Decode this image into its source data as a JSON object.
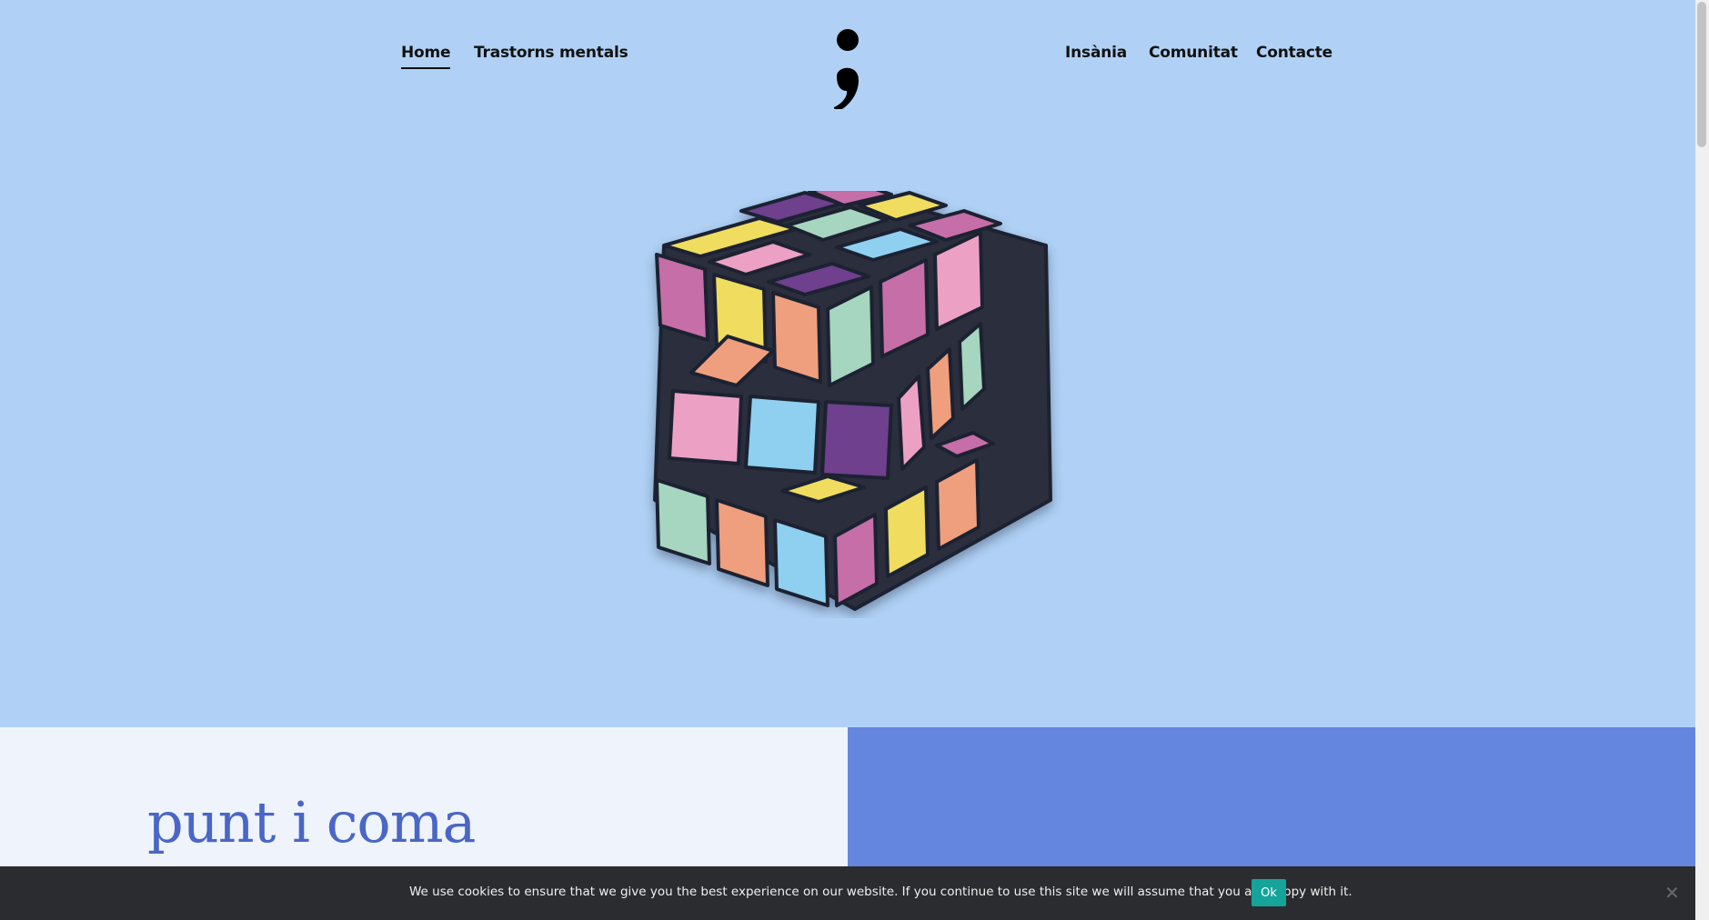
{
  "nav": {
    "left": [
      {
        "label": "Home",
        "active": true
      },
      {
        "label": "Trastorns mentals",
        "active": false
      }
    ],
    "right": [
      {
        "label": "Insània"
      },
      {
        "label": "Comunitat"
      },
      {
        "label": "Contacte"
      }
    ]
  },
  "logo": {
    "glyph": ";"
  },
  "hero": {
    "image": "rubiks-cube-illustration"
  },
  "intro": {
    "title": "punt i coma"
  },
  "cookie": {
    "message": "We use cookies to ensure that we give you the best experience on our website. If you continue to use this site we will assume that you are happy with it.",
    "ok_label": "Ok",
    "close_icon": "close-icon"
  },
  "colors": {
    "hero_bg": "#b0d1f5",
    "title": "#4a66c6",
    "panel_blue": "#6586de",
    "panel_light": "#eff4fc",
    "cookie_bg": "#2b2c30",
    "cookie_ok": "#14a49a"
  }
}
